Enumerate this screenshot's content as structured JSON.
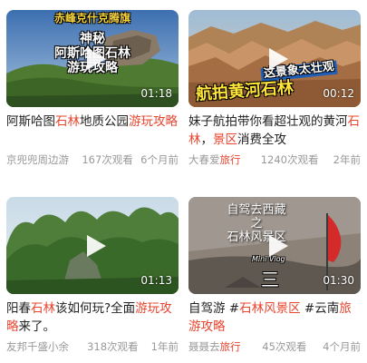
{
  "videos": [
    {
      "overlay_top": "赤峰克什克腾旗",
      "overlay_main": [
        "神秘",
        "阿斯哈图石林",
        "游玩攻略"
      ],
      "duration": "01:18",
      "title_parts": [
        {
          "text": "阿斯哈图",
          "hl": false
        },
        {
          "text": "石林",
          "hl": true
        },
        {
          "text": "地质公园",
          "hl": false
        },
        {
          "text": "游玩攻",
          "hl": true
        },
        {
          "text": "略",
          "hl": true
        }
      ],
      "author_parts": [
        {
          "text": "京兜兜周边游",
          "hl": false
        }
      ],
      "views": "167次观看",
      "time": "6个月前"
    },
    {
      "overlay_top": "这景象太壮观",
      "overlay_main": [
        "航拍黄河石林"
      ],
      "duration": "00:12",
      "title_parts": [
        {
          "text": "妹子航拍带你看超壮观的黄河",
          "hl": false
        },
        {
          "text": "石林",
          "hl": true
        },
        {
          "text": "，",
          "hl": false
        },
        {
          "text": "景区",
          "hl": true
        },
        {
          "text": "消费全攻",
          "hl": false
        }
      ],
      "author_parts": [
        {
          "text": "大春爱",
          "hl": false
        },
        {
          "text": "旅行",
          "hl": true
        }
      ],
      "views": "1240次观看",
      "time": "2年前"
    },
    {
      "overlay_top": "",
      "overlay_main": [],
      "duration": "01:13",
      "title_parts": [
        {
          "text": "阳春",
          "hl": false
        },
        {
          "text": "石林",
          "hl": true
        },
        {
          "text": "该如何玩?全面",
          "hl": false
        },
        {
          "text": "游玩攻",
          "hl": true
        },
        {
          "text": "略",
          "hl": true
        },
        {
          "text": "来了。",
          "hl": false
        }
      ],
      "author_parts": [
        {
          "text": "友邦千盛小余",
          "hl": false
        }
      ],
      "views": "318次观看",
      "time": "1年前"
    },
    {
      "overlay_top": "",
      "overlay_main": [
        "自驾去西藏",
        "之",
        "石林风景区"
      ],
      "overlay_small": "Mini Vlog",
      "overlay_num": "三",
      "duration": "01:30",
      "title_parts": [
        {
          "text": "自驾游 #",
          "hl": false
        },
        {
          "text": "石林",
          "hl": true
        },
        {
          "text": "风景区",
          "hl": true
        },
        {
          "text": " #云南",
          "hl": false
        },
        {
          "text": "旅",
          "hl": true
        },
        {
          "text": "游攻略",
          "hl": true
        }
      ],
      "author_parts": [
        {
          "text": "聂聂去",
          "hl": false
        },
        {
          "text": "旅行",
          "hl": true
        }
      ],
      "views": "45次观看",
      "time": "4个月前"
    }
  ],
  "colors": {
    "highlight": "#e8442e",
    "meta": "#999999",
    "title": "#222222"
  },
  "icons": {
    "play": "play-icon"
  }
}
